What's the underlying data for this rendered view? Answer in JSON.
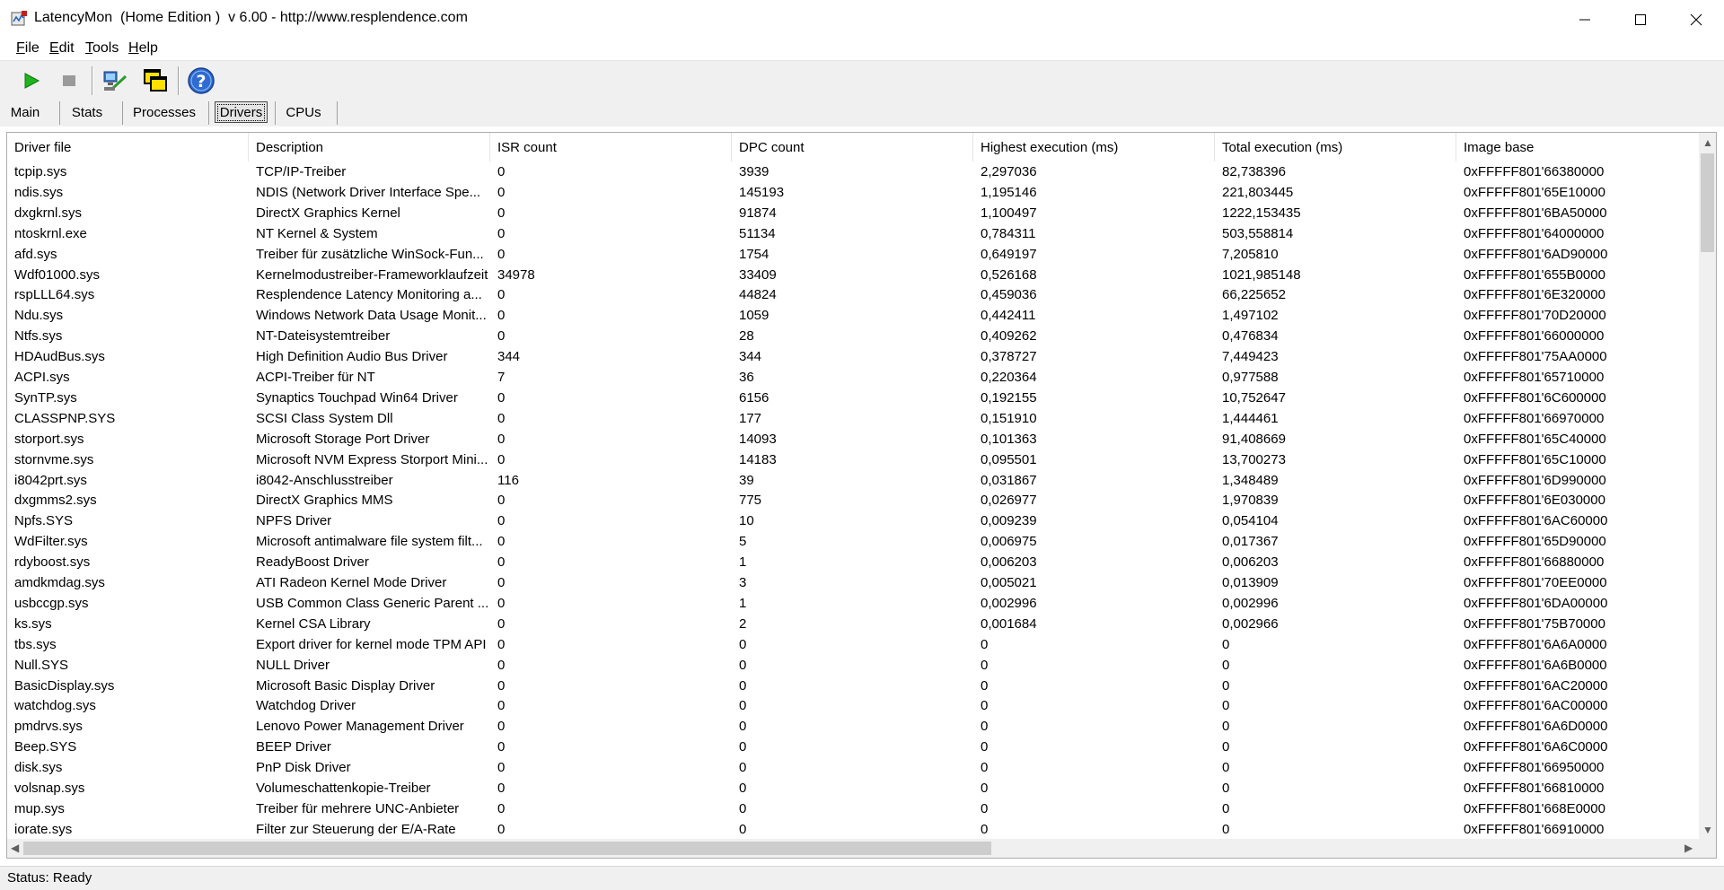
{
  "window": {
    "title": "LatencyMon  (Home Edition )  v 6.00 - http://www.resplendence.com"
  },
  "menu": {
    "items": [
      {
        "key": "F",
        "rest": "ile"
      },
      {
        "key": "E",
        "rest": "dit"
      },
      {
        "key": "T",
        "rest": "ools"
      },
      {
        "key": "H",
        "rest": "elp"
      }
    ]
  },
  "toolbar": {
    "icons": [
      "start-monitor-icon",
      "stop-monitor-icon",
      "connect-computer-icon",
      "copy-windows-icon",
      "help-icon"
    ]
  },
  "tabs": [
    {
      "label": "Main"
    },
    {
      "label": "Stats"
    },
    {
      "label": "Processes"
    },
    {
      "label": "Drivers"
    },
    {
      "label": "CPUs"
    }
  ],
  "grid": {
    "columns": [
      "Driver file",
      "Description",
      "ISR count",
      "DPC count",
      "Highest execution (ms)",
      "Total execution (ms)",
      "Image base"
    ],
    "rows": [
      [
        "tcpip.sys",
        "TCP/IP-Treiber",
        "0",
        "3939",
        "2,297036",
        "82,738396",
        "0xFFFFF801'66380000"
      ],
      [
        "ndis.sys",
        "NDIS (Network Driver Interface Spe...",
        "0",
        "145193",
        "1,195146",
        "221,803445",
        "0xFFFFF801'65E10000"
      ],
      [
        "dxgkrnl.sys",
        "DirectX Graphics Kernel",
        "0",
        "91874",
        "1,100497",
        "1222,153435",
        "0xFFFFF801'6BA50000"
      ],
      [
        "ntoskrnl.exe",
        "NT Kernel & System",
        "0",
        "51134",
        "0,784311",
        "503,558814",
        "0xFFFFF801'64000000"
      ],
      [
        "afd.sys",
        "Treiber für zusätzliche WinSock-Fun...",
        "0",
        "1754",
        "0,649197",
        "7,205810",
        "0xFFFFF801'6AD90000"
      ],
      [
        "Wdf01000.sys",
        "Kernelmodustreiber-Frameworklaufzeit",
        "34978",
        "33409",
        "0,526168",
        "1021,985148",
        "0xFFFFF801'655B0000"
      ],
      [
        "rspLLL64.sys",
        "Resplendence Latency Monitoring a...",
        "0",
        "44824",
        "0,459036",
        "66,225652",
        "0xFFFFF801'6E320000"
      ],
      [
        "Ndu.sys",
        "Windows Network Data Usage Monit...",
        "0",
        "1059",
        "0,442411",
        "1,497102",
        "0xFFFFF801'70D20000"
      ],
      [
        "Ntfs.sys",
        "NT-Dateisystemtreiber",
        "0",
        "28",
        "0,409262",
        "0,476834",
        "0xFFFFF801'66000000"
      ],
      [
        "HDAudBus.sys",
        "High Definition Audio Bus Driver",
        "344",
        "344",
        "0,378727",
        "7,449423",
        "0xFFFFF801'75AA0000"
      ],
      [
        "ACPI.sys",
        "ACPI-Treiber für NT",
        "7",
        "36",
        "0,220364",
        "0,977588",
        "0xFFFFF801'65710000"
      ],
      [
        "SynTP.sys",
        "Synaptics Touchpad Win64 Driver",
        "0",
        "6156",
        "0,192155",
        "10,752647",
        "0xFFFFF801'6C600000"
      ],
      [
        "CLASSPNP.SYS",
        "SCSI Class System Dll",
        "0",
        "177",
        "0,151910",
        "1,444461",
        "0xFFFFF801'66970000"
      ],
      [
        "storport.sys",
        "Microsoft Storage Port Driver",
        "0",
        "14093",
        "0,101363",
        "91,408669",
        "0xFFFFF801'65C40000"
      ],
      [
        "stornvme.sys",
        "Microsoft NVM Express Storport Mini...",
        "0",
        "14183",
        "0,095501",
        "13,700273",
        "0xFFFFF801'65C10000"
      ],
      [
        "i8042prt.sys",
        "i8042-Anschlusstreiber",
        "116",
        "39",
        "0,031867",
        "1,348489",
        "0xFFFFF801'6D990000"
      ],
      [
        "dxgmms2.sys",
        "DirectX Graphics MMS",
        "0",
        "775",
        "0,026977",
        "1,970839",
        "0xFFFFF801'6E030000"
      ],
      [
        "Npfs.SYS",
        "NPFS Driver",
        "0",
        "10",
        "0,009239",
        "0,054104",
        "0xFFFFF801'6AC60000"
      ],
      [
        "WdFilter.sys",
        "Microsoft antimalware file system filt...",
        "0",
        "5",
        "0,006975",
        "0,017367",
        "0xFFFFF801'65D90000"
      ],
      [
        "rdyboost.sys",
        "ReadyBoost Driver",
        "0",
        "1",
        "0,006203",
        "0,006203",
        "0xFFFFF801'66880000"
      ],
      [
        "amdkmdag.sys",
        "ATI Radeon Kernel Mode Driver",
        "0",
        "3",
        "0,005021",
        "0,013909",
        "0xFFFFF801'70EE0000"
      ],
      [
        "usbccgp.sys",
        "USB Common Class Generic Parent ...",
        "0",
        "1",
        "0,002996",
        "0,002996",
        "0xFFFFF801'6DA00000"
      ],
      [
        "ks.sys",
        "Kernel CSA Library",
        "0",
        "2",
        "0,001684",
        "0,002966",
        "0xFFFFF801'75B70000"
      ],
      [
        "tbs.sys",
        "Export driver for kernel mode TPM API",
        "0",
        "0",
        "0",
        "0",
        "0xFFFFF801'6A6A0000"
      ],
      [
        "Null.SYS",
        "NULL Driver",
        "0",
        "0",
        "0",
        "0",
        "0xFFFFF801'6A6B0000"
      ],
      [
        "BasicDisplay.sys",
        "Microsoft Basic Display Driver",
        "0",
        "0",
        "0",
        "0",
        "0xFFFFF801'6AC20000"
      ],
      [
        "watchdog.sys",
        "Watchdog Driver",
        "0",
        "0",
        "0",
        "0",
        "0xFFFFF801'6AC00000"
      ],
      [
        "pmdrvs.sys",
        "Lenovo Power Management Driver",
        "0",
        "0",
        "0",
        "0",
        "0xFFFFF801'6A6D0000"
      ],
      [
        "Beep.SYS",
        "BEEP Driver",
        "0",
        "0",
        "0",
        "0",
        "0xFFFFF801'6A6C0000"
      ],
      [
        "disk.sys",
        "PnP Disk Driver",
        "0",
        "0",
        "0",
        "0",
        "0xFFFFF801'66950000"
      ],
      [
        "volsnap.sys",
        "Volumeschattenkopie-Treiber",
        "0",
        "0",
        "0",
        "0",
        "0xFFFFF801'66810000"
      ],
      [
        "mup.sys",
        "Treiber für mehrere UNC-Anbieter",
        "0",
        "0",
        "0",
        "0",
        "0xFFFFF801'668E0000"
      ],
      [
        "iorate.sys",
        "Filter zur Steuerung der E/A-Rate",
        "0",
        "0",
        "0",
        "0",
        "0xFFFFF801'66910000"
      ]
    ]
  },
  "status": {
    "text": "Status: Ready"
  }
}
